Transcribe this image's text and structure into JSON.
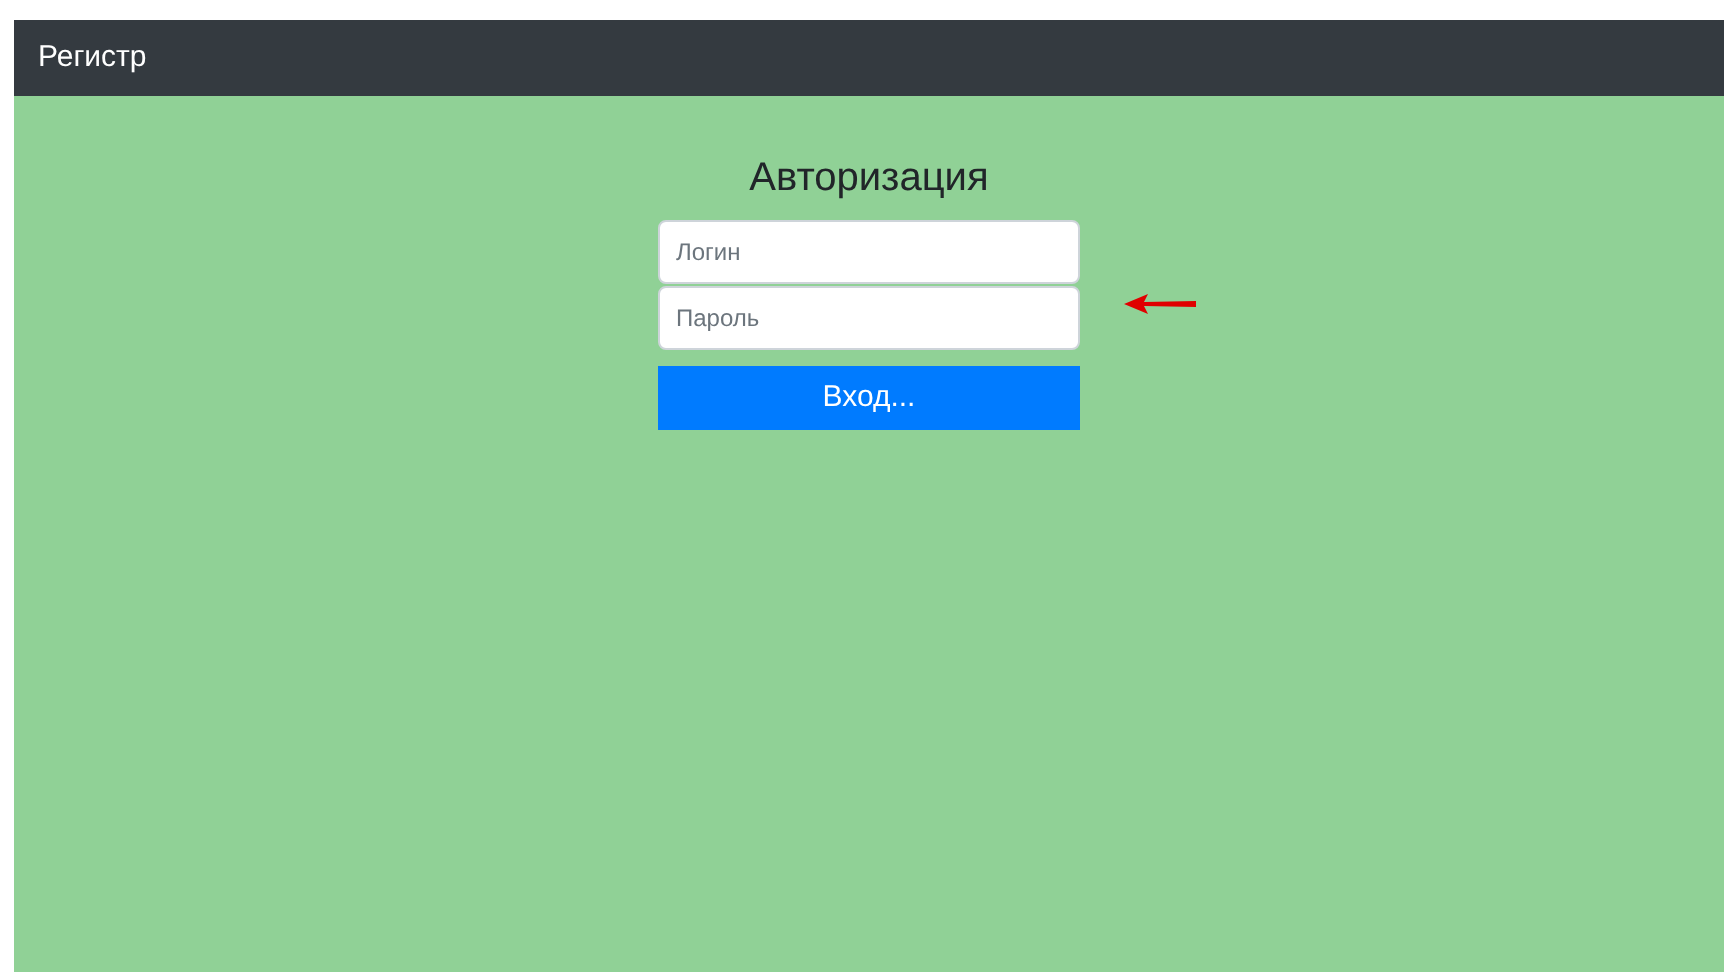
{
  "navbar": {
    "brand": "Регистр"
  },
  "form": {
    "title": "Авторизация",
    "fields": [
      {
        "placeholder": "Логин"
      },
      {
        "placeholder": "Пароль"
      }
    ],
    "button": "Вход..."
  }
}
